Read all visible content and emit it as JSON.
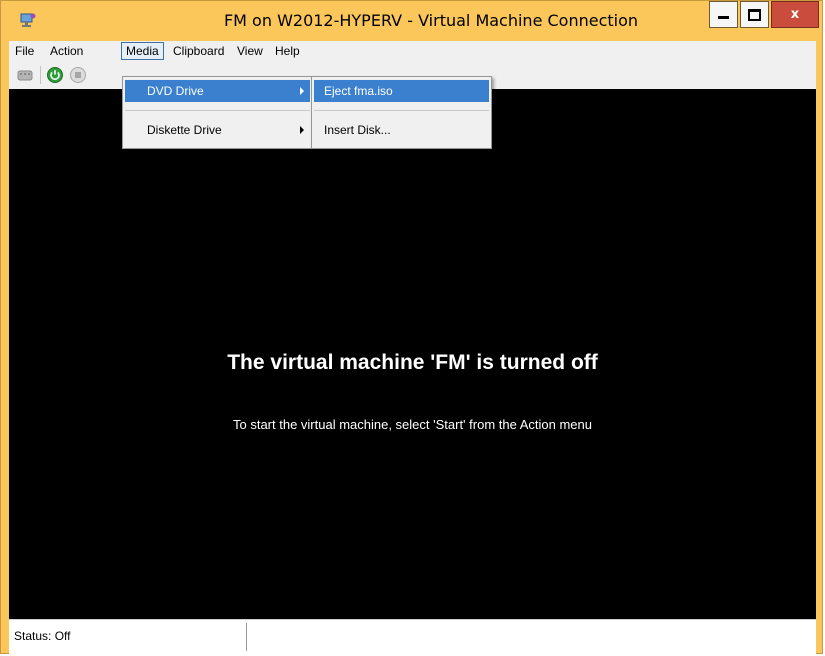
{
  "window": {
    "title": "FM on W2012-HYPERV - Virtual Machine Connection",
    "icon": "vm-connection-icon",
    "controls": [
      "minimize-icon",
      "maximize-icon",
      "close-icon"
    ],
    "close_label": "x"
  },
  "menubar": {
    "items": [
      "File",
      "Action",
      "Media",
      "Clipboard",
      "View",
      "Help"
    ],
    "active": "Media"
  },
  "toolbar": {
    "icons": [
      "ctrl-alt-del-icon",
      "start-icon",
      "turn-off-icon"
    ]
  },
  "media_menu": {
    "items": [
      {
        "label": "DVD Drive",
        "has_submenu": true,
        "highlighted": true
      },
      {
        "label": "Diskette Drive",
        "has_submenu": true,
        "highlighted": false
      }
    ]
  },
  "dvd_submenu": {
    "items": [
      {
        "label": "Eject fma.iso",
        "highlighted": true
      },
      {
        "label": "Insert Disk...",
        "highlighted": false
      }
    ]
  },
  "console": {
    "heading": "The virtual machine 'FM' is turned off",
    "hint": "To start the virtual machine, select 'Start' from the Action menu"
  },
  "statusbar": {
    "status": "Status: Off"
  },
  "colors": {
    "frame": "#fbc75b",
    "menu_highlight": "#3a80ce",
    "close_button": "#c94c3c",
    "start_green": "#2e9e3a"
  }
}
